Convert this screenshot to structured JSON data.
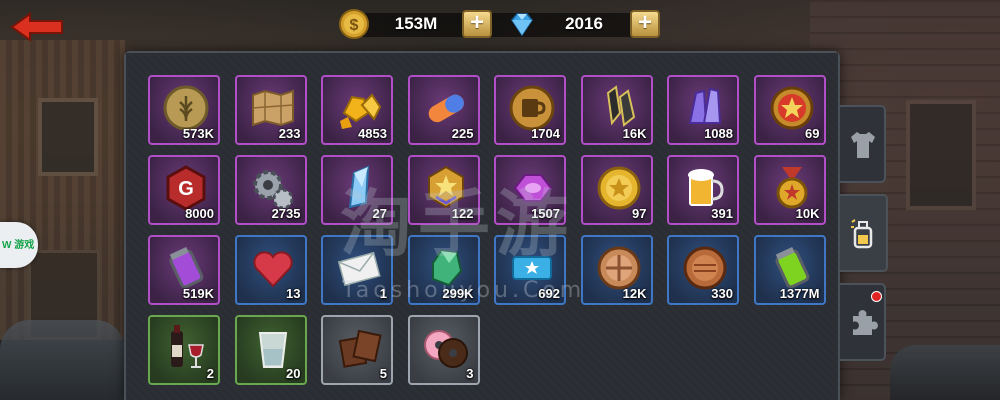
{
  "currency": {
    "gold": {
      "icon": "gold-coin-icon",
      "value": "153M"
    },
    "gems": {
      "icon": "diamond-icon",
      "value": "2016"
    },
    "plus_label": "+"
  },
  "inventory": [
    {
      "icon": "wheat-coin-icon",
      "qty": "573K",
      "rarity": "purple"
    },
    {
      "icon": "map-icon",
      "qty": "233",
      "rarity": "purple"
    },
    {
      "icon": "gold-nuggets-icon",
      "qty": "4853",
      "rarity": "purple"
    },
    {
      "icon": "capsule-icon",
      "qty": "225",
      "rarity": "purple"
    },
    {
      "icon": "beer-coin-icon",
      "qty": "1704",
      "rarity": "purple"
    },
    {
      "icon": "dark-crystal-icon",
      "qty": "16K",
      "rarity": "purple"
    },
    {
      "icon": "purple-crystal-icon",
      "qty": "1088",
      "rarity": "purple"
    },
    {
      "icon": "star-badge-icon",
      "qty": "69",
      "rarity": "purple"
    },
    {
      "icon": "g-token-icon",
      "qty": "8000",
      "rarity": "purple"
    },
    {
      "icon": "gears-icon",
      "qty": "2735",
      "rarity": "purple"
    },
    {
      "icon": "blue-crystal-icon",
      "qty": "27",
      "rarity": "purple"
    },
    {
      "icon": "rank-star-icon",
      "qty": "122",
      "rarity": "purple"
    },
    {
      "icon": "purple-gem-icon",
      "qty": "1507",
      "rarity": "purple"
    },
    {
      "icon": "gold-coin-icon",
      "qty": "97",
      "rarity": "purple"
    },
    {
      "icon": "beer-mug-icon",
      "qty": "391",
      "rarity": "purple"
    },
    {
      "icon": "medal-icon",
      "qty": "10K",
      "rarity": "purple"
    },
    {
      "icon": "purple-canister-icon",
      "qty": "519K",
      "rarity": "purple"
    },
    {
      "icon": "heart-icon",
      "qty": "13",
      "rarity": "blue"
    },
    {
      "icon": "envelope-icon",
      "qty": "1",
      "rarity": "blue"
    },
    {
      "icon": "green-gem-icon",
      "qty": "299K",
      "rarity": "blue"
    },
    {
      "icon": "ticket-icon",
      "qty": "692",
      "rarity": "blue"
    },
    {
      "icon": "clover-coin-icon",
      "qty": "12K",
      "rarity": "blue"
    },
    {
      "icon": "copper-coin-icon",
      "qty": "330",
      "rarity": "blue"
    },
    {
      "icon": "green-canister-icon",
      "qty": "1377M",
      "rarity": "blue"
    },
    {
      "icon": "wine-icon",
      "qty": "2",
      "rarity": "green"
    },
    {
      "icon": "shot-glass-icon",
      "qty": "20",
      "rarity": "green"
    },
    {
      "icon": "chocolate-icon",
      "qty": "5",
      "rarity": "gray"
    },
    {
      "icon": "donuts-icon",
      "qty": "3",
      "rarity": "gray"
    }
  ],
  "tabs": [
    {
      "icon": "shirt-icon",
      "active": false,
      "notification": false
    },
    {
      "icon": "potion-icon",
      "active": true,
      "notification": false
    },
    {
      "icon": "puzzle-icon",
      "active": false,
      "notification": true
    }
  ],
  "side_badge": {
    "label": "W 游戏"
  },
  "watermark": {
    "title": "淘手游",
    "url": "Taoshouyou.Com"
  },
  "colors": {
    "purple": "#b04fc6",
    "blue": "#3f77c4",
    "green": "#6aa84f",
    "gray": "#9ea5ae",
    "gold": "#d4a12c"
  }
}
